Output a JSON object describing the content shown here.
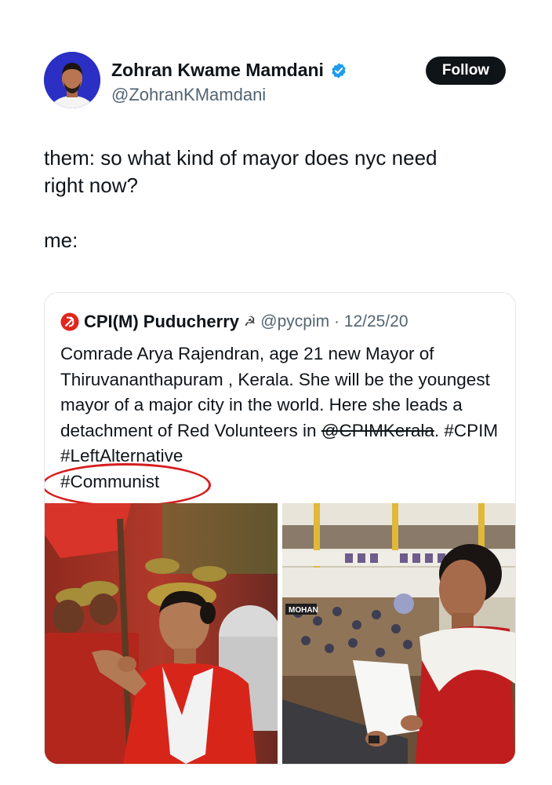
{
  "author": {
    "name": "Zohran Kwame Mamdani",
    "handle": "@ZohranKMamdani",
    "follow_label": "Follow"
  },
  "tweet": {
    "text": "them: so what kind of mayor does nyc need\nright now?\n\nme:"
  },
  "quoted": {
    "name": "CPI(M) Puducherry",
    "handle_date": "@pycpim · 12/25/20",
    "text_main": "Comrade Arya Rajendran, age 21  new Mayor of Thiruvananthapuram , Kerala. She will be the youngest mayor of a major city in the world. Here she leads a detachment of Red Volunteers in ",
    "mention": "@CPIMKerala",
    "text_tags": ". #CPIM  #LeftAlternative",
    "hashtag_circled": "#Communist",
    "photo_left_label": "",
    "photo_right_sign": "MOHAN"
  },
  "colors": {
    "accent_blue": "#1d9bf0",
    "follow_bg": "#0f1419",
    "annotation_red": "#d61d1d",
    "party_red": "#e0261d"
  },
  "icons": [
    "verified-badge-icon",
    "hammer-sickle-icon",
    "star-emoji-icon"
  ]
}
